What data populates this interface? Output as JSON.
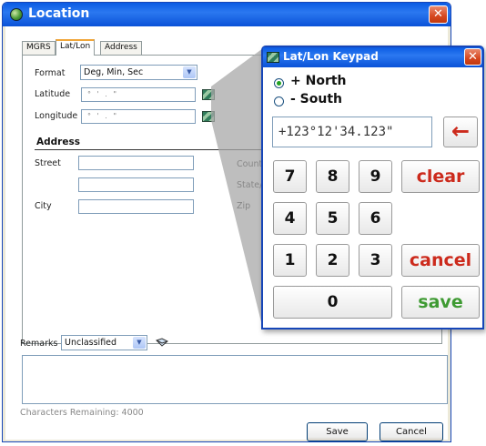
{
  "location": {
    "title": "Location",
    "tabs": [
      "MGRS",
      "Lat/Lon",
      "Address"
    ],
    "format_label": "Format",
    "format_value": "Deg, Min, Sec",
    "latitude_label": "Latitude",
    "longitude_label": "Longitude",
    "dms_placeholder": "°   '   .   \"",
    "address_title": "Address",
    "street_label": "Street",
    "city_label": "City",
    "country_label": "Countr",
    "state_label": "State/R",
    "zip_label": "Zip",
    "remarks_label": "Remarks",
    "remarks_value": "Unclassified",
    "chars_remaining": "Characters Remaining: 4000",
    "save_label": "Save",
    "cancel_label": "Cancel"
  },
  "keypad": {
    "title": "Lat/Lon Keypad",
    "north_label": "+ North",
    "south_label": "- South",
    "selected": "north",
    "display": "+123°12'34.123\"",
    "backspace_symbol": "←",
    "keys": [
      "7",
      "8",
      "9",
      "4",
      "5",
      "6",
      "1",
      "2",
      "3",
      "0"
    ],
    "clear_label": "clear",
    "cancel_label": "cancel",
    "save_label": "save"
  },
  "colors": {
    "titlebar": "#0a5be3",
    "red_text": "#cc2a1c",
    "green_text": "#3e9a32"
  }
}
